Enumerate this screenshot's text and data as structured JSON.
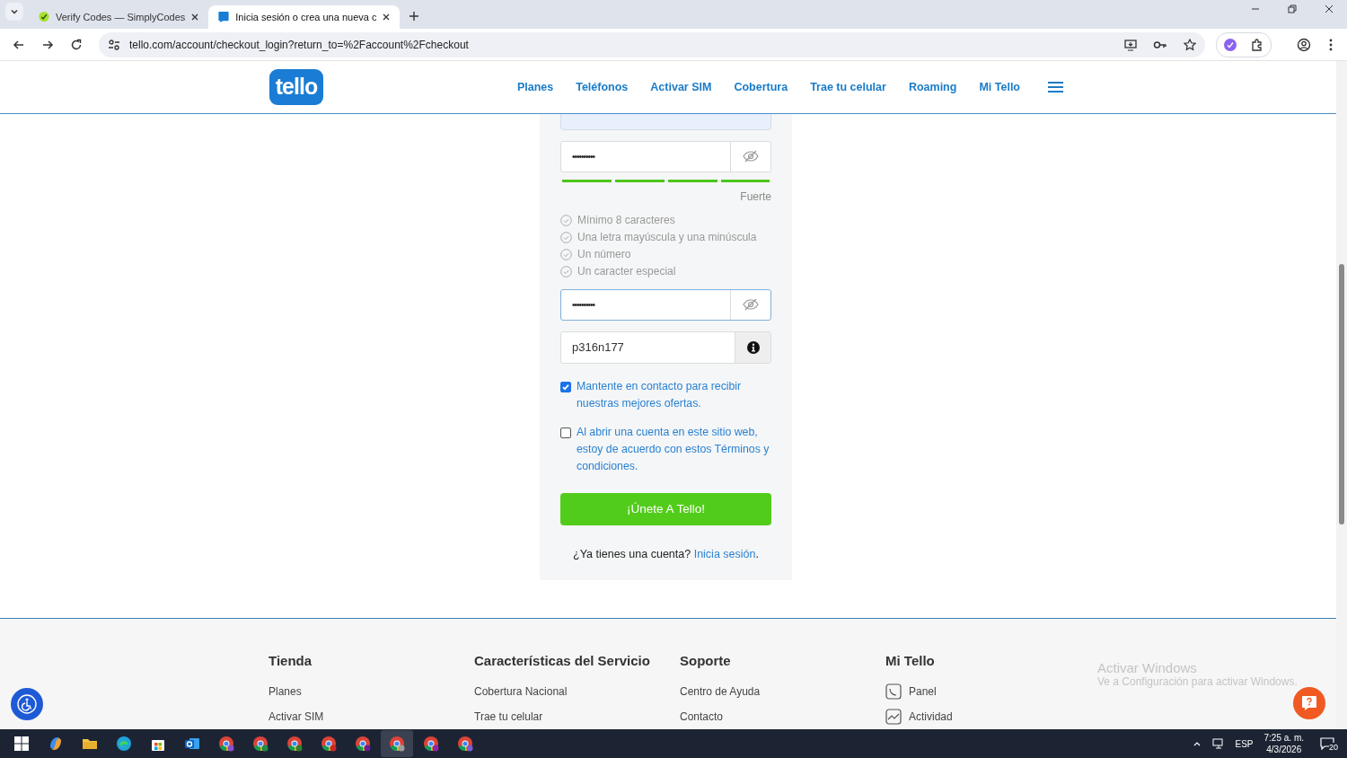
{
  "browser": {
    "tabs": [
      {
        "title": "Verify Codes — SimplyCodes",
        "selected": false,
        "kind": "simplycodes"
      },
      {
        "title": "Inicia sesión o crea una nueva c",
        "selected": true,
        "kind": "tello"
      }
    ],
    "url": "tello.com/account/checkout_login?return_to=%2Faccount%2Fcheckout"
  },
  "site_header": {
    "logo": "tello",
    "nav": [
      {
        "label": "Planes"
      },
      {
        "label": "Teléfonos"
      },
      {
        "label": "Activar SIM"
      },
      {
        "label": "Cobertura"
      },
      {
        "label": "Trae tu celular"
      },
      {
        "label": "Roaming"
      },
      {
        "label": "Mi Tello"
      }
    ]
  },
  "signup_form": {
    "password": {
      "value": "••••••••••",
      "focused": false
    },
    "strength": {
      "level": 1,
      "label": "Fuerte"
    },
    "requirements": [
      {
        "text": "Mínimo 8 caracteres",
        "met": true
      },
      {
        "text": "Una letra mayúscula y una minúscula",
        "met": true
      },
      {
        "text": "Un número",
        "met": true
      },
      {
        "text": "Un caracter especial",
        "met": true
      }
    ],
    "confirm_password": {
      "value": "••••••••••",
      "focused": true
    },
    "promo_code": "p316n177",
    "checkboxes": [
      {
        "text": "Mantente en contacto para recibir nuestras mejores ofertas.",
        "checked": true
      },
      {
        "text": "Al abrir una cuenta en este sitio web, estoy de acuerdo con estos Términos y condiciones.",
        "checked": false
      }
    ],
    "submit": "¡Únete A Tello!",
    "login_prompt": {
      "text": "¿Ya tienes una cuenta?",
      "link": "Inicia sesión",
      "end": "."
    }
  },
  "footer": {
    "columns": [
      {
        "title": "Tienda",
        "links": [
          {
            "text": "Planes"
          },
          {
            "text": "Activar SIM"
          }
        ]
      },
      {
        "title": "Características del Servicio",
        "links": [
          {
            "text": "Cobertura Nacional"
          },
          {
            "text": "Trae tu celular"
          }
        ]
      },
      {
        "title": "Soporte",
        "links": [
          {
            "text": "Centro de Ayuda"
          },
          {
            "text": "Contacto"
          }
        ]
      },
      {
        "title": "Mi Tello",
        "links": [
          {
            "text": "Panel",
            "kind": "phone"
          },
          {
            "text": "Actividad",
            "kind": "chart"
          }
        ]
      }
    ]
  },
  "windows_notice": {
    "title": "Activar Windows",
    "subtitle": "Ve a Configuración para activar Windows."
  },
  "taskbar": {
    "language": "ESP",
    "time": "7:25 a. m.",
    "date": "4/3/2026",
    "notifications": "20"
  }
}
